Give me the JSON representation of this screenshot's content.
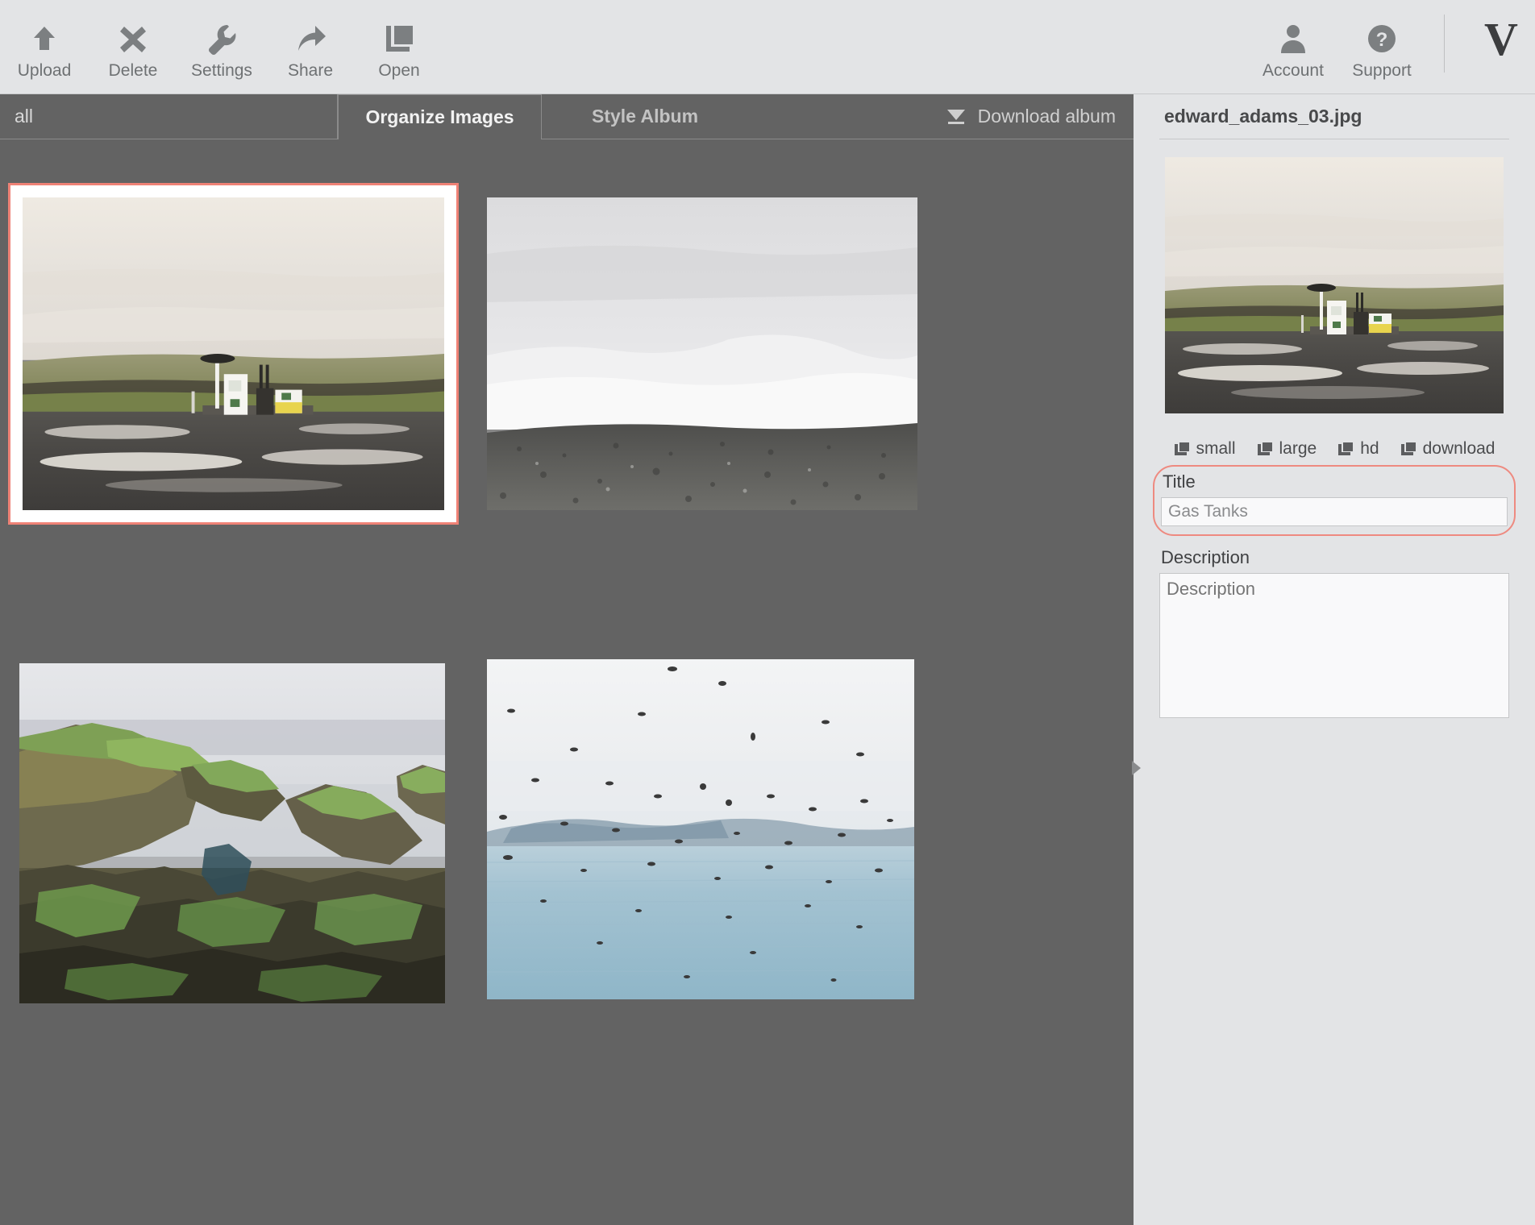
{
  "toolbar": {
    "left_buttons": [
      {
        "label": "Upload",
        "icon": "upload-arrow-icon"
      },
      {
        "label": "Delete",
        "icon": "x-cross-icon"
      },
      {
        "label": "Settings",
        "icon": "wrench-icon"
      },
      {
        "label": "Share",
        "icon": "share-arrow-icon"
      },
      {
        "label": "Open",
        "icon": "open-windows-icon"
      }
    ],
    "right_buttons": [
      {
        "label": "Account",
        "icon": "person-icon"
      },
      {
        "label": "Support",
        "icon": "question-circle-icon"
      }
    ],
    "brand": "V"
  },
  "tabs": {
    "all_label": "all",
    "organize_label": "Organize Images",
    "style_label": "Style Album",
    "download_label": "Download album",
    "download_icon": "download-triangle-icon",
    "active": "Organize Images"
  },
  "gallery": {
    "items": [
      {
        "alt": "Gas station with pumps on a plain under overcast sky",
        "selected": true
      },
      {
        "alt": "Grey volcanic gravel plain with low clouds",
        "selected": false
      },
      {
        "alt": "Green mossy sea cliffs in mist",
        "selected": false
      },
      {
        "alt": "Flock of birds flying over the ocean near an island",
        "selected": false
      }
    ]
  },
  "sidebar": {
    "filename": "edward_adams_03.jpg",
    "preview_alt": "Gas station with pumps on a plain under overcast sky",
    "size_links": [
      {
        "label": "small",
        "icon": "windows-copy-icon"
      },
      {
        "label": "large",
        "icon": "windows-copy-icon"
      },
      {
        "label": "hd",
        "icon": "windows-copy-icon"
      },
      {
        "label": "download",
        "icon": "windows-copy-icon"
      }
    ],
    "title_label": "Title",
    "title_value": "Gas Tanks",
    "title_placeholder": "Title",
    "description_label": "Description",
    "description_value": "",
    "description_placeholder": "Description",
    "collapse_icon": "triangle-right-icon"
  },
  "colors": {
    "toolbar_bg": "#e3e4e6",
    "content_bg": "#636363",
    "selection_red": "#ef8276",
    "icon_gray": "#7c7f81",
    "text_dark": "#48494b"
  }
}
